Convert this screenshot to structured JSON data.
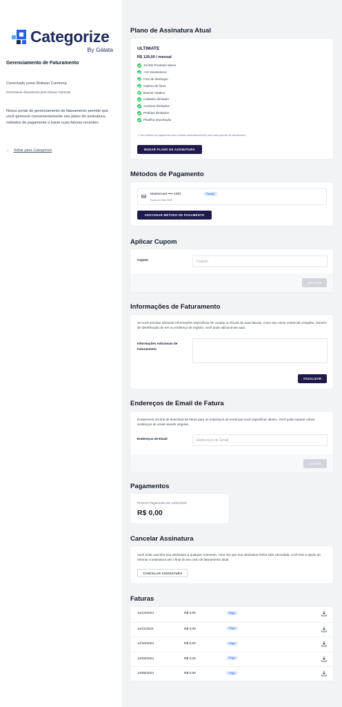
{
  "brand": {
    "name": "Categorize",
    "sub": "By Gálata",
    "colors": {
      "primary": "#1e2a5a",
      "accent": "#2563eb",
      "light": "#60a5fa"
    }
  },
  "sidebar": {
    "title": "Gerenciamento de Faturamento",
    "connected": "Conectado como Robson Carmona",
    "managing": "Gerenciando faturamento para Robson Carmona",
    "description": "Nosso portal de gerenciamento de faturamento permite que você gerencie convenientemente seu plano de assinatura, métodos de pagamento e baixe suas faturas recentes.",
    "back_label": "Voltar para Categorize",
    "back_icon": "arrow-left-icon"
  },
  "plan": {
    "section_title": "Plano de Assinatura Atual",
    "name": "ULTIMATE",
    "price": "R$ 129,00 / mensal",
    "features": [
      "10.000 Produtos ativos",
      "+10 Vendedores",
      "Foto de destaque",
      "Galeria de fotos",
      "Banner rotativo",
      "Cadastro ilimitado",
      "Acessos ilimitados",
      "Pedidos ilimitados",
      "Planilha importação"
    ],
    "note": "Seu método de pagamento será cobrado automaticamente para cada período de faturamento.",
    "change_button": "MUDAR PLANO DE ASSINATURA"
  },
  "payment_methods": {
    "section_title": "Métodos de Pagamento",
    "card_label": "Mastercard •••• 1387",
    "badge": "Padrão",
    "expiry": "Expira em Sep 2029",
    "add_button": "ADICIONAR MÉTODO DE PAGAMENTO"
  },
  "coupon": {
    "section_title": "Aplicar Cupom",
    "label": "Cupom",
    "placeholder": "Cupom",
    "value": "",
    "apply_button": "APLICAR"
  },
  "billing_info": {
    "section_title": "Informações de Faturamento",
    "description": "Se você precisar adicionar informações específicas de contato ou fiscais às suas faturas, como seu nome comercial completo, número de identificação de IVA ou endereço de registro, você pode adicioná-las aqui.",
    "label": "Informações Adicionais de Faturamento",
    "value": "",
    "update_button": "ATUALIZAR"
  },
  "invoice_emails": {
    "section_title": "Endereços de Email de Fatura",
    "description": "Enviaremos um link de download da fatura para os endereços de email que você especificar abaixo. Você pode separar vários endereços de email usando vírgulas.",
    "label": "Endereços de Email",
    "placeholder": "Endereços de Email",
    "value": "",
    "save_button": "SALVAR"
  },
  "payments": {
    "section_title": "Pagamentos",
    "next_label": "Próximo Pagamento em 14/01/2025",
    "amount": "R$ 0,00"
  },
  "cancel": {
    "section_title": "Cancelar Assinatura",
    "description": "Você pode cancelar sua assinatura a qualquer momento. Uma vez que sua assinatura tenha sido cancelada, você terá a opção de retomar a assinatura até o final do seu ciclo de faturamento atual.",
    "button": "CANCELAR ASSINATURA"
  },
  "invoices": {
    "section_title": "Faturas",
    "rows": [
      {
        "date": "14/12/2024",
        "amount": "R$ 0,00",
        "status": "Pago"
      },
      {
        "date": "14/11/2024",
        "amount": "R$ 0,00",
        "status": "Pago"
      },
      {
        "date": "14/10/2024",
        "amount": "R$ 0,00",
        "status": "Pago"
      },
      {
        "date": "14/09/2024",
        "amount": "R$ 0,00",
        "status": "Pago"
      },
      {
        "date": "14/08/2024",
        "amount": "R$ 0,00",
        "status": "Pago"
      }
    ],
    "download_icon": "download-icon"
  }
}
